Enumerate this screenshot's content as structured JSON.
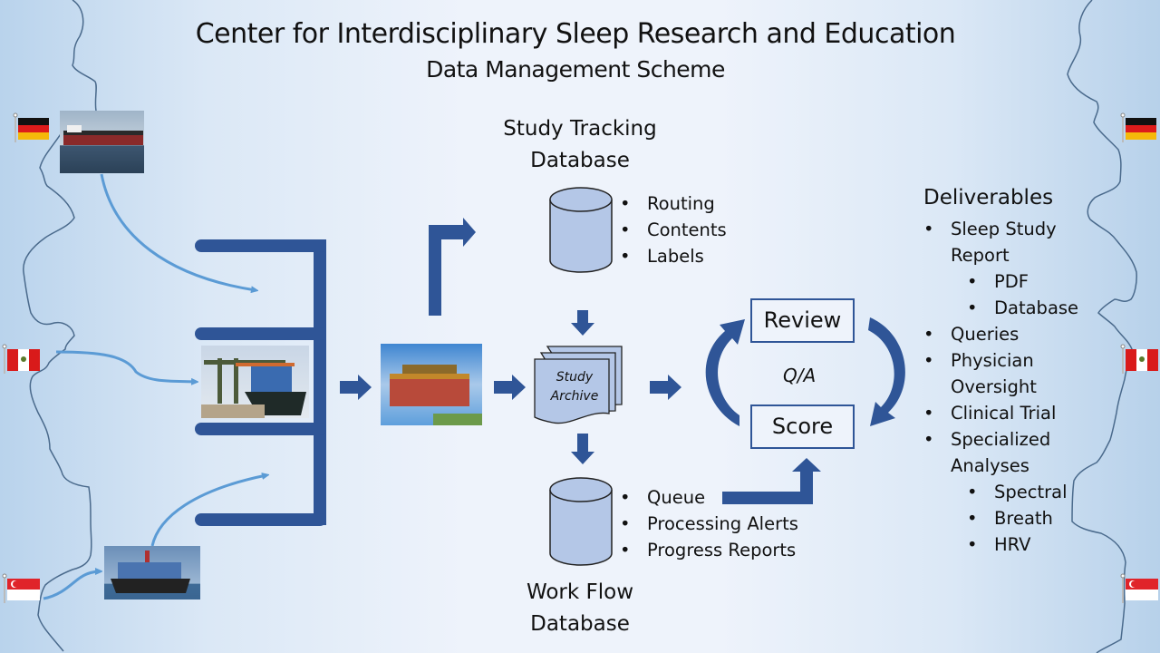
{
  "header": {
    "title": "Center for Interdisciplinary Sleep Research and Education",
    "subtitle": "Data Management Scheme"
  },
  "colors": {
    "accent": "#2f5597",
    "light_arrow": "#5b9bd5",
    "cylinder_fill": "#b4c7e7",
    "background_center": "#eef3fb",
    "background_edge": "#b9d3ec"
  },
  "sources": [
    {
      "country": "Germany",
      "flag_icon": "germany-flag-icon",
      "image": "oil-tanker-ship-photo"
    },
    {
      "country": "Peru",
      "flag_icon": "peru-flag-icon",
      "image": "port-crane-container-ship-photo"
    },
    {
      "country": "Singapore",
      "flag_icon": "singapore-flag-icon",
      "image": "container-ship-photo"
    }
  ],
  "right_flags": [
    "Germany",
    "Peru",
    "Singapore"
  ],
  "study_tracking_db": {
    "label_line1": "Study Tracking",
    "label_line2": "Database",
    "items": [
      "Routing",
      "Contents",
      "Labels"
    ]
  },
  "study_archive": {
    "line1": "Study",
    "line2": "Archive"
  },
  "work_flow_db": {
    "label_line1": "Work Flow",
    "label_line2": "Database",
    "items": [
      "Queue",
      "Processing Alerts",
      "Progress Reports"
    ]
  },
  "review_cycle": {
    "review": "Review",
    "score": "Score",
    "qa": "Q/A"
  },
  "deliverables": {
    "heading": "Deliverables",
    "items": [
      {
        "text": "Sleep Study",
        "level": 1
      },
      {
        "text": "Report",
        "level": 1,
        "continuation": true
      },
      {
        "text": "PDF",
        "level": 2
      },
      {
        "text": "Database",
        "level": 2
      },
      {
        "text": "Queries",
        "level": 1
      },
      {
        "text": "Physician",
        "level": 1
      },
      {
        "text": "Oversight",
        "level": 1,
        "continuation": true
      },
      {
        "text": "Clinical Trial",
        "level": 1
      },
      {
        "text": "Specialized",
        "level": 1
      },
      {
        "text": "Analyses",
        "level": 1,
        "continuation": true
      },
      {
        "text": "Spectral",
        "level": 2
      },
      {
        "text": "Breath",
        "level": 2
      },
      {
        "text": "HRV",
        "level": 2
      }
    ]
  }
}
